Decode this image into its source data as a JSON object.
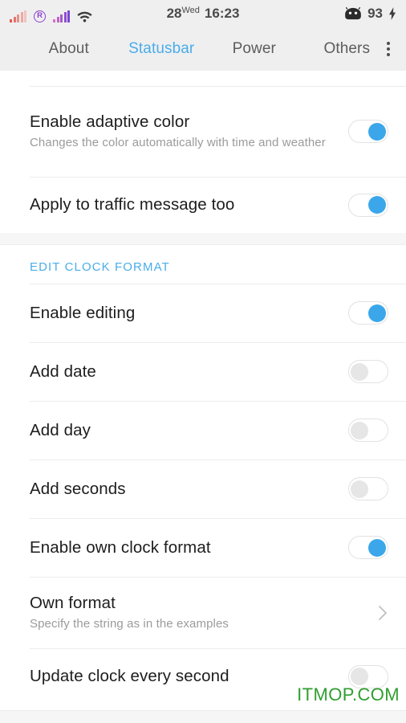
{
  "statusbar": {
    "signal_primary_icon": "signal-bars-icon",
    "roaming_icon": "roaming-r-icon",
    "roaming_label": "R",
    "signal_secondary_icon": "signal-bars-icon",
    "wifi_icon": "wifi-icon",
    "date_number": "28",
    "day_abbrev": "Wed",
    "time": "16:23",
    "battery_icon": "android-robot-icon",
    "battery_percent": "93",
    "charging_icon": "lightning-bolt-icon"
  },
  "tabs": [
    {
      "label": "About",
      "active": false
    },
    {
      "label": "Statusbar",
      "active": true
    },
    {
      "label": "Power",
      "active": false
    },
    {
      "label": "Others",
      "active": false
    }
  ],
  "overflow_menu_icon": "more-vertical-icon",
  "rows_top": [
    {
      "title": "Enable adaptive color",
      "subtitle": "Changes the color automatically with time and weather",
      "control": "toggle",
      "state": "on"
    },
    {
      "title": "Apply to traffic message too",
      "subtitle": "",
      "control": "toggle",
      "state": "on"
    }
  ],
  "section": {
    "header": "EDIT CLOCK FORMAT",
    "rows": [
      {
        "title": "Enable editing",
        "subtitle": "",
        "control": "toggle",
        "state": "on"
      },
      {
        "title": "Add date",
        "subtitle": "",
        "control": "toggle",
        "state": "off"
      },
      {
        "title": "Add day",
        "subtitle": "",
        "control": "toggle",
        "state": "off"
      },
      {
        "title": "Add seconds",
        "subtitle": "",
        "control": "toggle",
        "state": "off"
      },
      {
        "title": "Enable own clock format",
        "subtitle": "",
        "control": "toggle",
        "state": "on"
      },
      {
        "title": "Own format",
        "subtitle": "Specify the string as in the examples",
        "control": "chevron",
        "state": ""
      },
      {
        "title": "Update clock every second",
        "subtitle": "",
        "control": "toggle",
        "state": "off"
      }
    ]
  },
  "watermark": "ITMOP.COM",
  "colors": {
    "accent": "#4aade9",
    "toggle_on": "#3ba7ea",
    "toggle_off": "#e6e6e6",
    "header_bg": "#efeff0",
    "watermark": "#2f9e2f"
  }
}
